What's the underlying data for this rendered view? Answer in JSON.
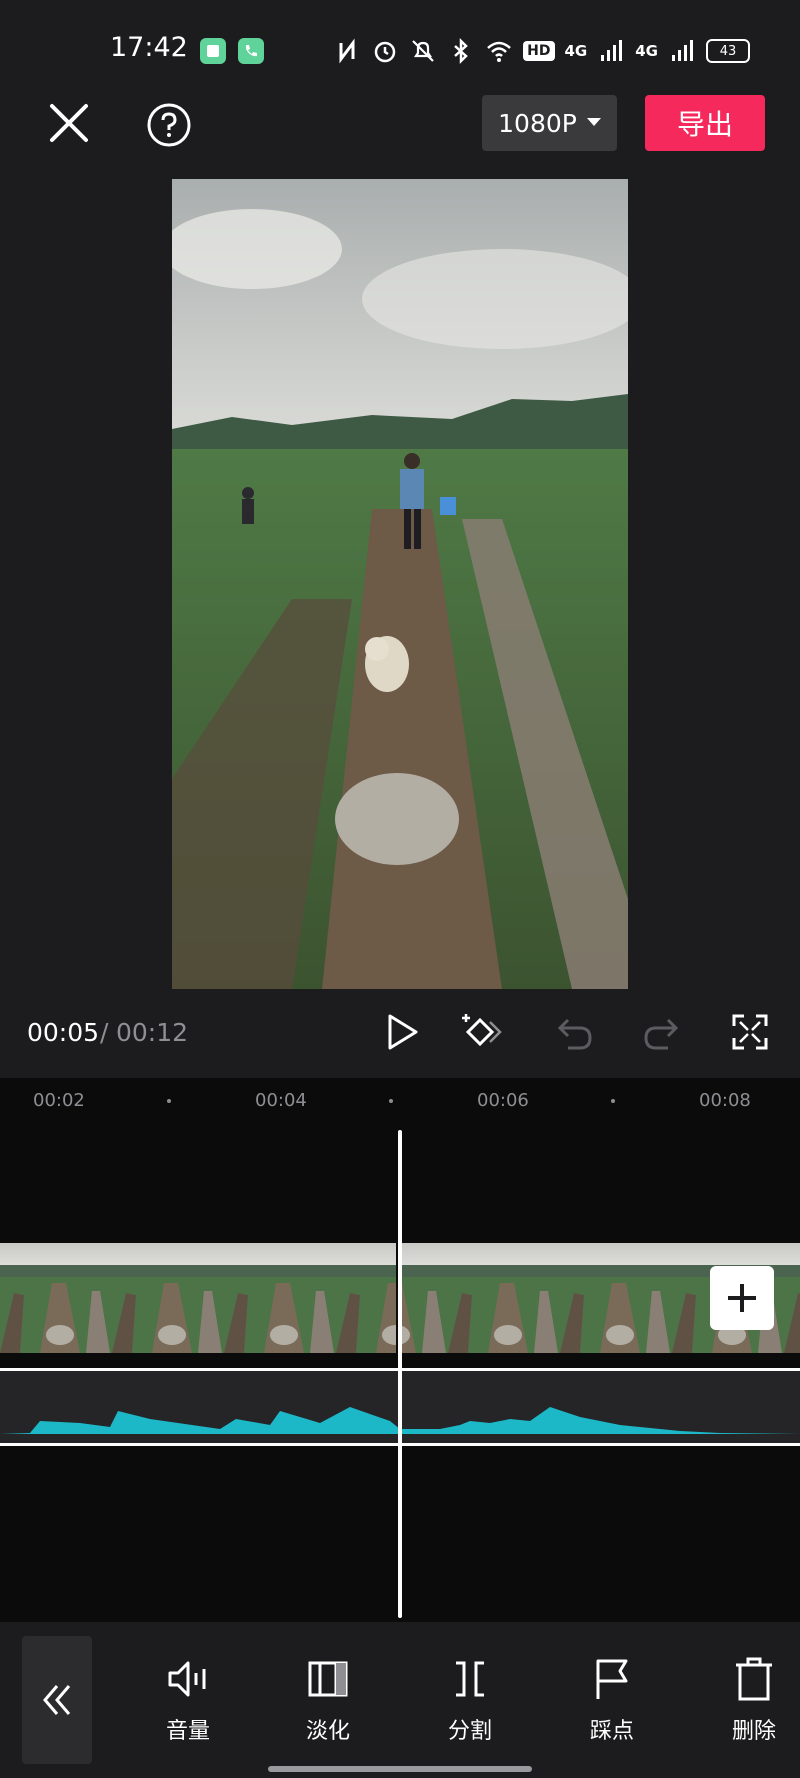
{
  "status_bar": {
    "time": "17:42",
    "network_1": "4G",
    "network_2": "4G",
    "hd_label": "HD",
    "battery": "43",
    "icons": [
      "nfc-icon",
      "alarm-icon",
      "mute-icon",
      "bluetooth-icon",
      "wifi-icon",
      "hd-icon",
      "signal-icon",
      "battery-icon"
    ]
  },
  "toolbar": {
    "close_icon": "close-icon",
    "help_icon": "help-icon",
    "resolution": "1080P",
    "export_label": "导出",
    "export_color": "#f6295d"
  },
  "playback": {
    "current_time": "00:05",
    "separator": "/",
    "total_time": "00:12",
    "icons": [
      "play-icon",
      "keyframe-icon",
      "undo-icon",
      "redo-icon",
      "fullscreen-icon"
    ]
  },
  "timeline": {
    "ruler": [
      "00:02",
      "00:04",
      "00:06",
      "00:08"
    ],
    "add_clip_icon": "plus-icon",
    "audio_color": "#1cb8c8"
  },
  "bottom_toolbar": {
    "collapse_icon": "double-chevron-left-icon",
    "items": [
      {
        "label": "音量",
        "icon": "volume-icon"
      },
      {
        "label": "淡化",
        "icon": "fade-icon"
      },
      {
        "label": "分割",
        "icon": "split-icon"
      },
      {
        "label": "踩点",
        "icon": "beat-flag-icon"
      },
      {
        "label": "删除",
        "icon": "delete-icon"
      }
    ]
  }
}
